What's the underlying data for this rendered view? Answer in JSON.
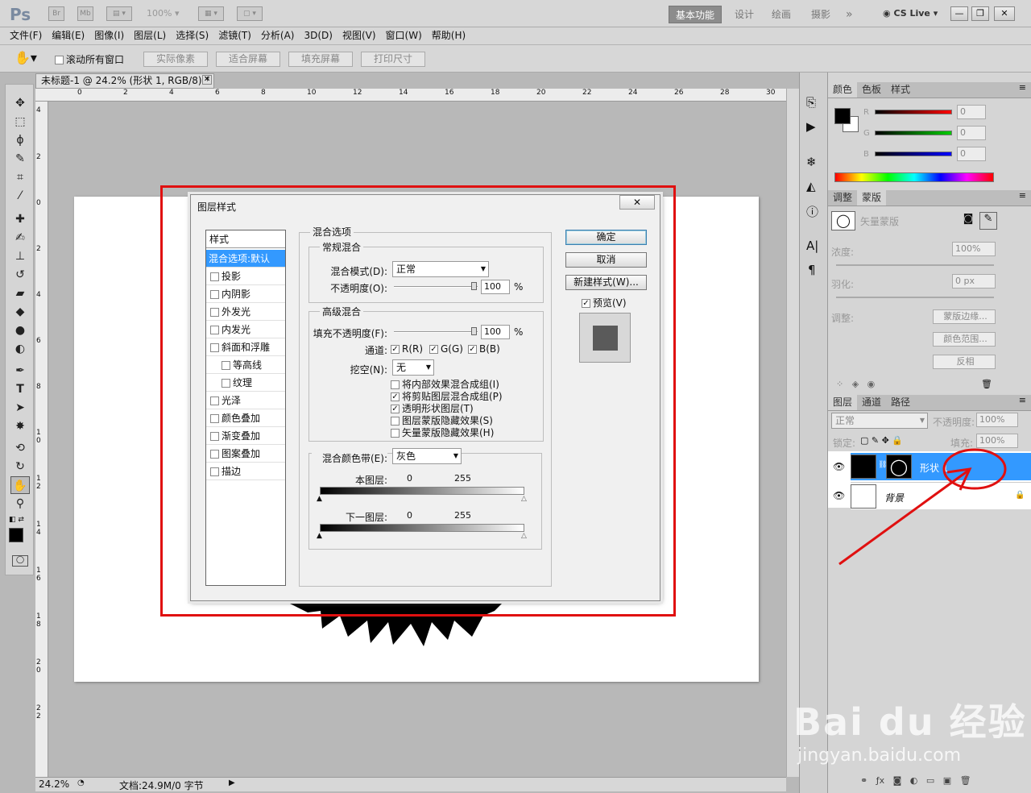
{
  "app": {
    "logo": "Ps",
    "zoom_select": "100%",
    "workspaces": [
      "基本功能",
      "设计",
      "绘画",
      "摄影"
    ],
    "cslive": "CS Live"
  },
  "menu": [
    "文件(F)",
    "编辑(E)",
    "图像(I)",
    "图层(L)",
    "选择(S)",
    "滤镜(T)",
    "分析(A)",
    "3D(D)",
    "视图(V)",
    "窗口(W)",
    "帮助(H)"
  ],
  "options": {
    "scroll_all": "滚动所有窗口",
    "buttons": [
      "实际像素",
      "适合屏幕",
      "填充屏幕",
      "打印尺寸"
    ]
  },
  "document": {
    "tab_title": "未标题-1 @ 24.2% (形状 1, RGB/8) *",
    "ruler_top": [
      "0",
      "2",
      "4",
      "6",
      "8",
      "10",
      "12",
      "14",
      "16",
      "18",
      "20",
      "22",
      "24",
      "26",
      "28",
      "30"
    ],
    "ruler_left": [
      "4",
      "2",
      "0",
      "2",
      "4",
      "6",
      "8",
      "1 0",
      "1 2",
      "1 4",
      "1 6",
      "1 8",
      "2 0",
      "2 2"
    ],
    "zoom": "24.2%",
    "status": "文档:24.9M/0 字节"
  },
  "dialog": {
    "title": "图层样式",
    "styles_header": "样式",
    "styles": [
      {
        "label": "混合选项:默认",
        "selected": true,
        "checkbox": false,
        "indent": false
      },
      {
        "label": "投影",
        "checkbox": true,
        "indent": false
      },
      {
        "label": "内阴影",
        "checkbox": true,
        "indent": false
      },
      {
        "label": "外发光",
        "checkbox": true,
        "indent": false
      },
      {
        "label": "内发光",
        "checkbox": true,
        "indent": false
      },
      {
        "label": "斜面和浮雕",
        "checkbox": true,
        "indent": false
      },
      {
        "label": "等高线",
        "checkbox": true,
        "indent": true
      },
      {
        "label": "纹理",
        "checkbox": true,
        "indent": true
      },
      {
        "label": "光泽",
        "checkbox": true,
        "indent": false
      },
      {
        "label": "颜色叠加",
        "checkbox": true,
        "indent": false
      },
      {
        "label": "渐变叠加",
        "checkbox": true,
        "indent": false
      },
      {
        "label": "图案叠加",
        "checkbox": true,
        "indent": false
      },
      {
        "label": "描边",
        "checkbox": true,
        "indent": false
      }
    ],
    "blend_options": "混合选项",
    "general_blend": "常规混合",
    "blend_mode_label": "混合模式(D):",
    "blend_mode": "正常",
    "opacity_label": "不透明度(O):",
    "opacity": "100",
    "pct": "%",
    "advanced_blend": "高级混合",
    "fill_opacity_label": "填充不透明度(F):",
    "fill_opacity": "100",
    "channels_label": "通道:",
    "channels": [
      "R(R)",
      "G(G)",
      "B(B)"
    ],
    "knockout_label": "挖空(N):",
    "knockout": "无",
    "options": [
      {
        "label": "将内部效果混合成组(I)",
        "checked": false
      },
      {
        "label": "将剪贴图层混合成组(P)",
        "checked": true
      },
      {
        "label": "透明形状图层(T)",
        "checked": true
      },
      {
        "label": "图层蒙版隐藏效果(S)",
        "checked": false
      },
      {
        "label": "矢量蒙版隐藏效果(H)",
        "checked": false
      }
    ],
    "blend_if_label": "混合颜色带(E):",
    "blend_if": "灰色",
    "this_layer": "本图层:",
    "underlying_layer": "下一图层:",
    "range_min": "0",
    "range_max": "255",
    "ok": "确定",
    "cancel": "取消",
    "new_style": "新建样式(W)...",
    "preview": "预览(V)"
  },
  "color_panel": {
    "tabs": [
      "颜色",
      "色板",
      "样式"
    ],
    "channels": [
      {
        "label": "R",
        "value": "0",
        "color": "#ff0000"
      },
      {
        "label": "G",
        "value": "0",
        "color": "#00cc00"
      },
      {
        "label": "B",
        "value": "0",
        "color": "#0000ff"
      }
    ]
  },
  "masks_panel": {
    "tabs": [
      "调整",
      "蒙版"
    ],
    "vector_mask": "矢量蒙版",
    "density_label": "浓度:",
    "density": "100%",
    "feather_label": "羽化:",
    "feather": "0 px",
    "refine_label": "调整:",
    "buttons": [
      "蒙版边缘...",
      "颜色范围...",
      "反相"
    ]
  },
  "layers_panel": {
    "tabs": [
      "图层",
      "通道",
      "路径"
    ],
    "blend_mode": "正常",
    "opacity_label": "不透明度:",
    "opacity": "100%",
    "lock_label": "锁定:",
    "fill_label": "填充:",
    "fill": "100%",
    "layers": [
      {
        "name": "形状 1",
        "selected": true
      },
      {
        "name": "背景",
        "selected": false
      }
    ]
  },
  "annotation_color": "#e01010",
  "watermark": "Bai du 经验 jingyan.baidu.com"
}
